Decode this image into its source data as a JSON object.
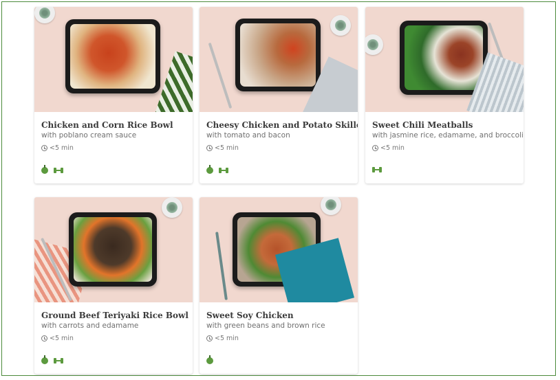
{
  "cards": [
    {
      "title": "Chicken and Corn Rice Bowl",
      "subtitle": "with poblano cream sauce",
      "time": "<5 min",
      "badges": [
        "apple-icon",
        "dumbbell-icon"
      ]
    },
    {
      "title": "Cheesy Chicken and Potato Skillet",
      "subtitle": "with tomato and bacon",
      "time": "<5 min",
      "badges": [
        "apple-icon",
        "dumbbell-icon"
      ]
    },
    {
      "title": "Sweet Chili Meatballs",
      "subtitle": "with jasmine rice, edamame, and broccoli",
      "time": "<5 min",
      "badges": [
        "dumbbell-icon"
      ]
    },
    {
      "title": "Ground Beef Teriyaki Rice Bowl",
      "subtitle": "with carrots and edamame",
      "time": "<5 min",
      "badges": [
        "apple-icon",
        "dumbbell-icon"
      ]
    },
    {
      "title": "Sweet Soy Chicken",
      "subtitle": "with green beans and brown rice",
      "time": "<5 min",
      "badges": [
        "apple-icon"
      ]
    }
  ],
  "colors": {
    "frame": "#4a8a3a",
    "badge": "#5c9a3e",
    "photo_bg": "#f1d8cf",
    "tray": "#1b1b1b"
  }
}
